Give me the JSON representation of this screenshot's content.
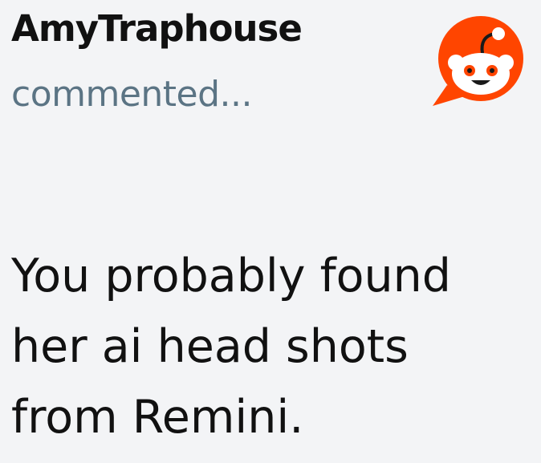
{
  "comment": {
    "username": "AmyTraphouse",
    "action": "commented...",
    "body": "You probably found her ai head shots from Remini."
  },
  "logo": {
    "icon": "reddit-snoo-icon",
    "color": "#ff4500"
  }
}
